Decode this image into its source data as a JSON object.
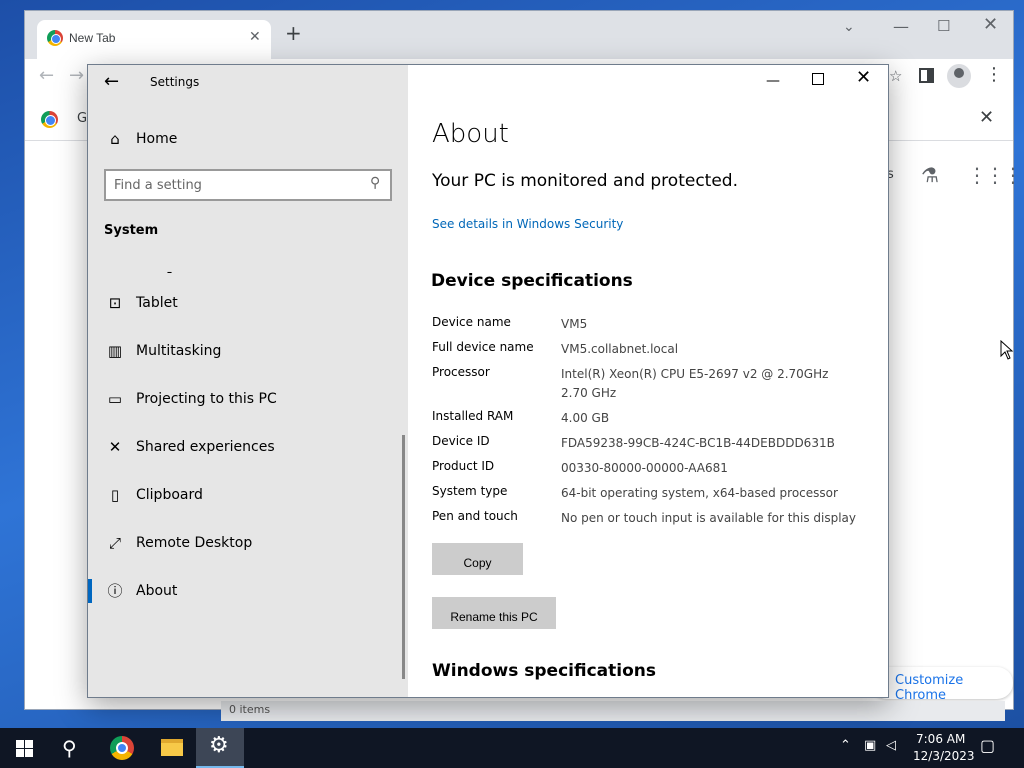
{
  "chrome": {
    "tab_title": "New Tab",
    "tab_close": "✕",
    "new_tab": "+",
    "tab_search": "⌄",
    "minimize": "—",
    "maximize": "☐",
    "close": "✕",
    "back": "←",
    "forward": "→",
    "bookmark": "☆",
    "menu": "⋮",
    "infobar_text": "Go",
    "infobar_close": "✕",
    "gmail_fragment": "s",
    "labs": "⚗",
    "apps": "⋮⋮⋮",
    "customize_label": "Customize Chrome",
    "items_text": "0 items"
  },
  "settings": {
    "back": "←",
    "app_title": "Settings",
    "minimize": "—",
    "close": "✕",
    "nav": {
      "home_icon": "⌂",
      "home_label": "Home",
      "search_placeholder": "Find a setting",
      "search_icon": "⚲",
      "section": "System",
      "items": [
        {
          "label": "Tablet",
          "icon": "tablet-icon",
          "glyph": "⊡",
          "active": false
        },
        {
          "label": "Multitasking",
          "icon": "multitasking-icon",
          "glyph": "▥",
          "active": false
        },
        {
          "label": "Projecting to this PC",
          "icon": "projecting-icon",
          "glyph": "▭",
          "active": false
        },
        {
          "label": "Shared experiences",
          "icon": "shared-experiences-icon",
          "glyph": "✕",
          "active": false
        },
        {
          "label": "Clipboard",
          "icon": "clipboard-icon",
          "glyph": "▯",
          "active": false
        },
        {
          "label": "Remote Desktop",
          "icon": "remote-desktop-icon",
          "glyph": "⤢",
          "active": false
        },
        {
          "label": "About",
          "icon": "info-icon",
          "glyph": "ⓘ",
          "active": true
        }
      ]
    },
    "about": {
      "title": "About",
      "protection_status": "Your PC is monitored and protected.",
      "security_link": "See details in Windows Security",
      "device_specs_heading": "Device specifications",
      "specs": [
        {
          "label": "Device name",
          "value": "VM5"
        },
        {
          "label": "Full device name",
          "value": "VM5.collabnet.local"
        },
        {
          "label": "Processor",
          "value": "Intel(R) Xeon(R) CPU E5-2697 v2 @ 2.70GHz 2.70 GHz"
        },
        {
          "label": "Installed RAM",
          "value": "4.00 GB"
        },
        {
          "label": "Device ID",
          "value": "FDA59238-99CB-424C-BC1B-44DEBDDD631B"
        },
        {
          "label": "Product ID",
          "value": "00330-80000-00000-AA681"
        },
        {
          "label": "System type",
          "value": "64-bit operating system, x64-based processor"
        },
        {
          "label": "Pen and touch",
          "value": "No pen or touch input is available for this display"
        }
      ],
      "copy_button": "Copy",
      "rename_button": "Rename this PC",
      "windows_specs_heading": "Windows specifications"
    }
  },
  "taskbar": {
    "search_glyph": "⚲",
    "settings_glyph": "⚙",
    "tray_chevron": "⌃",
    "tray_network": "▣",
    "tray_volume": "◁",
    "time": "7:06 AM",
    "date": "12/3/2023",
    "notifications_glyph": "▢"
  }
}
